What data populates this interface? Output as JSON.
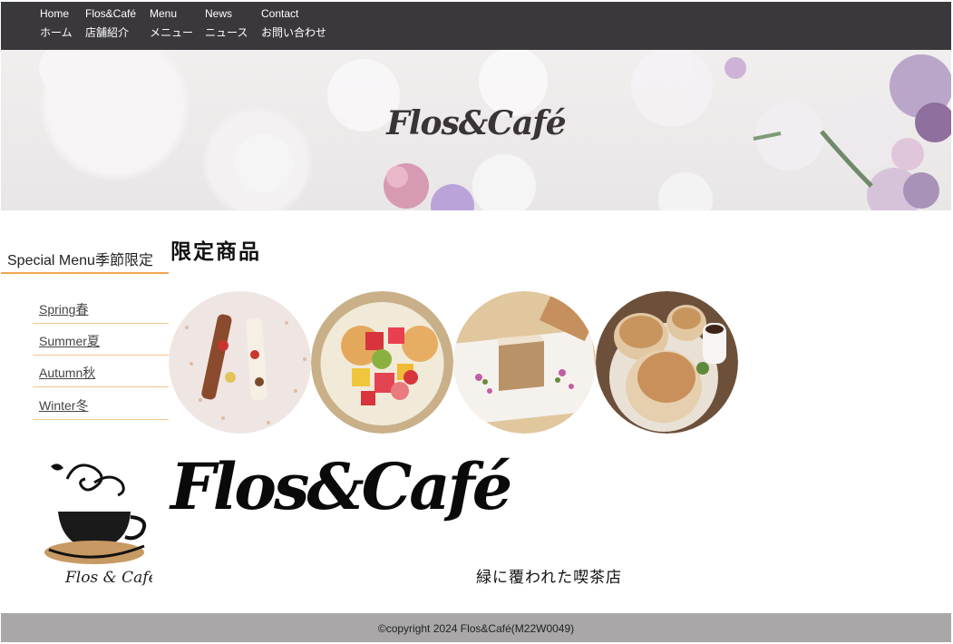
{
  "nav": {
    "items": [
      {
        "en": "Home",
        "jp": "ホーム"
      },
      {
        "en": "Flos&Café",
        "jp": "店舗紹介"
      },
      {
        "en": "Menu",
        "jp": "メニュー"
      },
      {
        "en": "News",
        "jp": "ニュース"
      },
      {
        "en": "Contact",
        "jp": "お問い合わせ"
      }
    ]
  },
  "hero": {
    "title": "Flos&Café"
  },
  "sidebar": {
    "title": "Special Menu季節限定",
    "items": [
      {
        "label": "Spring春"
      },
      {
        "label": "Summer夏"
      },
      {
        "label": "Autumn秋"
      },
      {
        "label": "Winter冬"
      }
    ]
  },
  "main": {
    "heading": "限定商品",
    "products": [
      {
        "icon": "dessert-plate-image"
      },
      {
        "icon": "fruit-pancake-image"
      },
      {
        "icon": "cake-slice-image"
      },
      {
        "icon": "souffle-pancake-image"
      }
    ],
    "logo_text": "Flos&Café",
    "tagline": "緑に覆われた喫茶店",
    "cup_logo_text": "Flos & Café"
  },
  "footer": {
    "copyright": "©copyright 2024 Flos&Café(M22W0049)"
  },
  "colors": {
    "nav_bg": "#3b383d",
    "accent": "#f0a850",
    "footer_bg": "#a9a7a8"
  }
}
